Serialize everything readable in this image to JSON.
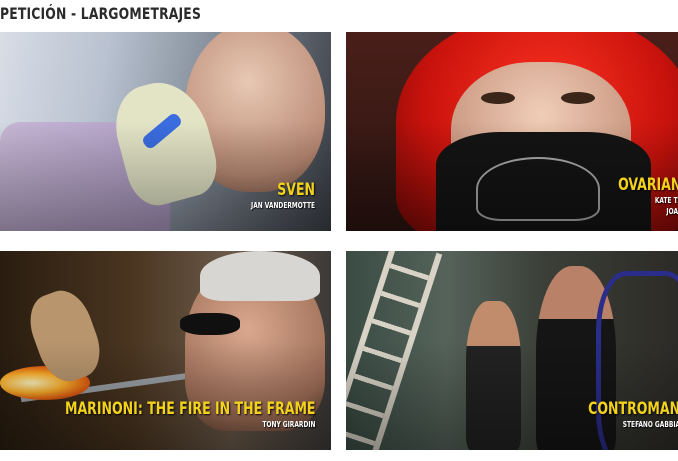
{
  "section": {
    "title": "PETICIÓN - LARGOMETRAJES"
  },
  "films": [
    {
      "title": "SVEN",
      "director": "JAN VANDERMOTTE"
    },
    {
      "title": "OVARIAN PSYCO",
      "director_line1": "KATE TRUMBULL-LAVAL",
      "director_line2": "JOANNA SOKOLOWS"
    },
    {
      "title": "MARINONI: THE FIRE IN THE FRAME",
      "director": "TONY GIRARDIN"
    },
    {
      "title": "CONTROMAN",
      "director": "STEFANO GABBIA"
    }
  ],
  "colors": {
    "film_title": "#f2d21a",
    "director": "#ffffff",
    "section_title": "#2b2b2b"
  }
}
